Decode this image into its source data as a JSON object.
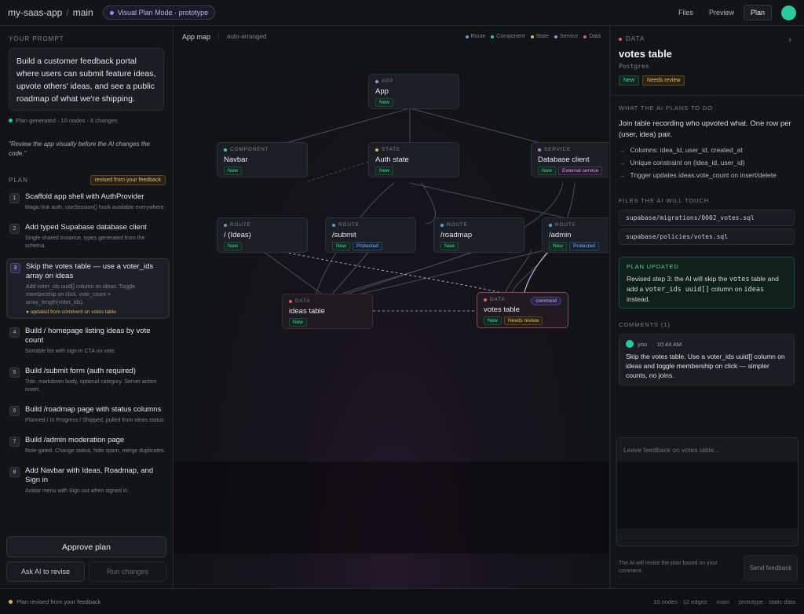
{
  "topbar": {
    "project": "my-saas-app",
    "branch": "main",
    "mode": "Visual Plan Mode · prototype",
    "actions": [
      "Files",
      "Preview",
      "Plan"
    ]
  },
  "left": {
    "prompt_label": "YOUR PROMPT",
    "prompt": "Build a customer feedback portal where users can submit feature ideas, upvote others' ideas, and see a public roadmap of what we're shipping.",
    "plan_generated": "Plan generated · 10 nodes · 6 changes",
    "quote": "\"Review the app visually before the AI changes the code.\"",
    "plan_label": "PLAN",
    "revised_badge": "revised from your feedback",
    "steps": [
      {
        "num": "1",
        "title": "Scaffold app shell with AuthProvider",
        "sub": "Magic-link auth, useSession() hook available everywhere.",
        "note": ""
      },
      {
        "num": "2",
        "title": "Add typed Supabase database client",
        "sub": "Single shared instance, types generated from the schema.",
        "note": ""
      },
      {
        "num": "3",
        "title": "Skip the votes table — use a voter_ids array on ideas",
        "sub": "Add voter_ids uuid[] column on ideas. Toggle membership on click. vote_count = array_length(voter_ids).",
        "note": "● updated from comment on votes table"
      },
      {
        "num": "4",
        "title": "Build / homepage listing ideas by vote count",
        "sub": "Sortable list with sign-in CTA on vote.",
        "note": ""
      },
      {
        "num": "5",
        "title": "Build /submit form (auth required)",
        "sub": "Title, markdown body, optional category. Server action insert.",
        "note": ""
      },
      {
        "num": "6",
        "title": "Build /roadmap page with status columns",
        "sub": "Planned / In Progress / Shipped, pulled from ideas.status.",
        "note": ""
      },
      {
        "num": "7",
        "title": "Build /admin moderation page",
        "sub": "Role-gated. Change status, hide spam, merge duplicates.",
        "note": ""
      },
      {
        "num": "8",
        "title": "Add Navbar with Ideas, Roadmap, and Sign in",
        "sub": "Avatar menu with Sign out when signed in.",
        "note": ""
      }
    ],
    "approve": "Approve plan",
    "ask": "Ask AI to revise",
    "run": "Run changes"
  },
  "canvas": {
    "title": "App map",
    "subtitle": "auto-arranged",
    "legend": [
      {
        "label": "Route",
        "color": "#4aa3e8"
      },
      {
        "label": "Component",
        "color": "#2fc7a0"
      },
      {
        "label": "State",
        "color": "#e2b15d"
      },
      {
        "label": "Service",
        "color": "#c77ae0"
      },
      {
        "label": "Data",
        "color": "#e0606f"
      }
    ],
    "nodes": {
      "app": {
        "kind": "APP",
        "name": "App",
        "tags": [
          "New"
        ]
      },
      "navbar": {
        "kind": "COMPONENT",
        "name": "Navbar",
        "tags": [
          "New"
        ]
      },
      "auth": {
        "kind": "STATE",
        "name": "Auth state",
        "tags": [
          "New"
        ]
      },
      "db": {
        "kind": "SERVICE",
        "name": "Database client",
        "tags": [
          "New",
          "External service"
        ]
      },
      "ideas_route": {
        "kind": "ROUTE",
        "name": "/ (Ideas)",
        "tags": [
          "New"
        ]
      },
      "submit": {
        "kind": "ROUTE",
        "name": "/submit",
        "tags": [
          "New",
          "Protected"
        ]
      },
      "roadmap": {
        "kind": "ROUTE",
        "name": "/roadmap",
        "tags": [
          "New"
        ]
      },
      "admin": {
        "kind": "ROUTE",
        "name": "/admin",
        "tags": [
          "New",
          "Protected"
        ]
      },
      "ideas_table": {
        "kind": "DATA",
        "name": "ideas table",
        "tags": [
          "New"
        ]
      },
      "votes_table": {
        "kind": "DATA",
        "name": "votes table",
        "tags": [
          "New",
          "Needs review"
        ],
        "comment": "comment"
      }
    }
  },
  "right": {
    "kind": "DATA",
    "title": "votes table",
    "subtitle": "Postgres",
    "tags": [
      "New",
      "Needs review"
    ],
    "plans_label": "WHAT THE AI PLANS TO DO",
    "description": "Join table recording who upvoted what. One row per (user, idea) pair.",
    "bullets": [
      "Columns: idea_id, user_id, created_at",
      "Unique constraint on (idea_id, user_id)",
      "Trigger updates ideas.vote_count on insert/delete"
    ],
    "files_label": "FILES THE AI WILL TOUCH",
    "files": [
      "supabase/migrations/0002_votes.sql",
      "supabase/policies/votes.sql"
    ],
    "plan_updated_title": "PLAN UPDATED",
    "plan_updated_parts": [
      "Revised step 3: the AI will skip the ",
      "votes",
      " table and add a ",
      "voter_ids uuid[]",
      " column on ",
      "ideas",
      " instead."
    ],
    "comments_label": "COMMENTS (1)",
    "comment": {
      "author": "you",
      "time": "10:44 AM",
      "body": "Skip the votes table. Use a voter_ids uuid[] column on ideas and toggle membership on click — simpler counts, no joins."
    },
    "feedback_placeholder": "Leave feedback on votes table...",
    "footer": "The AI will revise the plan based on your comment.",
    "send": "Send feedback"
  },
  "bottombar": {
    "status": "Plan revised from your feedback",
    "stats": "10 nodes · 12 edges",
    "branch": "main",
    "env": "prototype · static data"
  }
}
